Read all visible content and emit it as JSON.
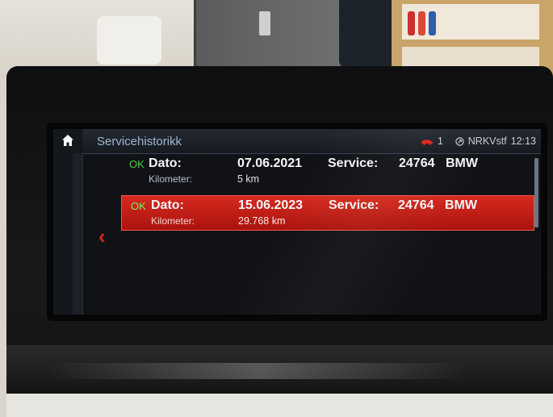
{
  "screen": {
    "title": "Servicehistorikk",
    "status": {
      "vehicle_count": "1",
      "radio_station": "NRKVstf",
      "time": "12:13",
      "car_icon": "car-icon",
      "radio_icon": "radio-icon"
    },
    "home_icon": "home-icon",
    "back_icon": "chevron-left-icon",
    "accent_color": "#e2231a",
    "entries": [
      {
        "status": "OK",
        "date_label": "Dato:",
        "date": "07.06.2021",
        "km_label": "Kilometer:",
        "km": "5 km",
        "service_label": "Service:",
        "service_code": "24764",
        "brand": "BMW"
      },
      {
        "status": "OK",
        "date_label": "Dato:",
        "date": "15.06.2023",
        "km_label": "Kilometer:",
        "km": "29.768 km",
        "service_label": "Service:",
        "service_code": "24764",
        "brand": "BMW"
      }
    ],
    "selected_index": 1
  }
}
